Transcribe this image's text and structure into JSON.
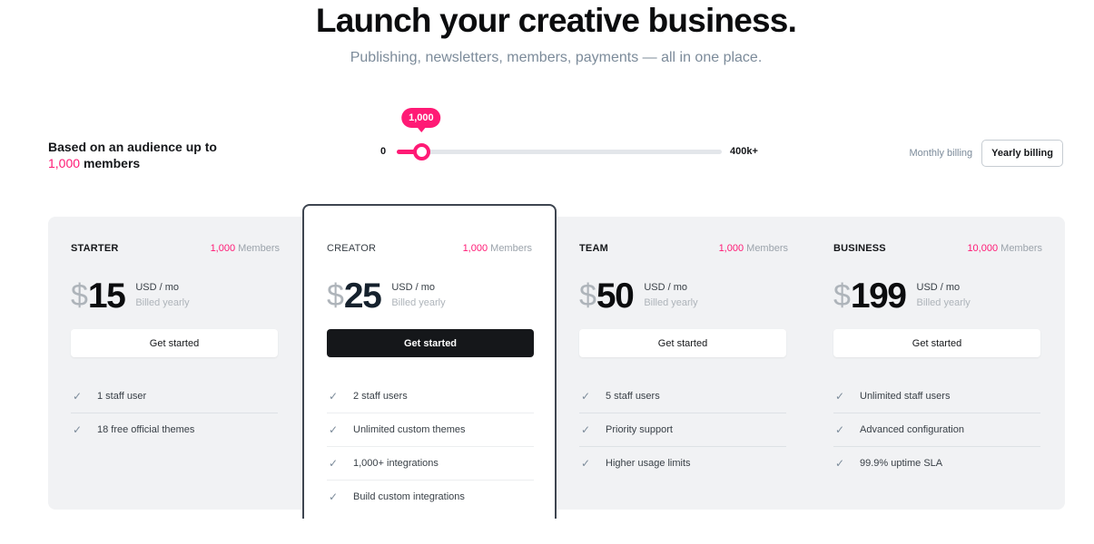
{
  "hero": {
    "title": "Launch your creative business.",
    "subtitle": "Publishing, newsletters, members, payments — all in one place."
  },
  "audience": {
    "prefix": "Based on an audience up to",
    "count": "1,000",
    "suffix": "members"
  },
  "slider": {
    "min_label": "0",
    "max_label": "400k+",
    "value_label": "1,000",
    "position_fraction": 0.075
  },
  "billing": {
    "options": [
      "Monthly billing",
      "Yearly billing"
    ],
    "selected": "Yearly billing"
  },
  "colors": {
    "accent": "#ff1a75",
    "dark": "#15171a",
    "panel": "#f1f2f4"
  },
  "plans": [
    {
      "name": "STARTER",
      "members_count": "1,000",
      "members_label": "Members",
      "currency": "$",
      "price": "15",
      "unit": "USD / mo",
      "billed": "Billed yearly",
      "cta": "Get started",
      "features": [
        "1 staff user",
        "18 free official themes"
      ]
    },
    {
      "name": "CREATOR",
      "members_count": "1,000",
      "members_label": "Members",
      "currency": "$",
      "price": "25",
      "unit": "USD / mo",
      "billed": "Billed yearly",
      "cta": "Get started",
      "featured": true,
      "features": [
        "2 staff users",
        "Unlimited custom themes",
        "1,000+ integrations",
        "Build custom integrations"
      ]
    },
    {
      "name": "TEAM",
      "members_count": "1,000",
      "members_label": "Members",
      "currency": "$",
      "price": "50",
      "unit": "USD / mo",
      "billed": "Billed yearly",
      "cta": "Get started",
      "features": [
        "5 staff users",
        "Priority support",
        "Higher usage limits"
      ]
    },
    {
      "name": "BUSINESS",
      "members_count": "10,000",
      "members_label": "Members",
      "currency": "$",
      "price": "199",
      "unit": "USD / mo",
      "billed": "Billed yearly",
      "cta": "Get started",
      "features": [
        "Unlimited staff users",
        "Advanced configuration",
        "99.9% uptime SLA"
      ]
    }
  ]
}
